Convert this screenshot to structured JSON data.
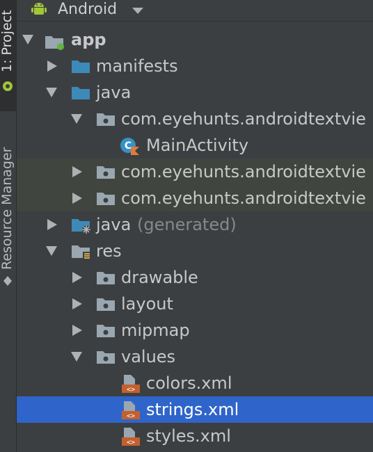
{
  "left_strip": {
    "project_tab": "1: Project",
    "resource_manager_tab": "Resource Manager"
  },
  "header": {
    "view_mode": "Android"
  },
  "tree": {
    "app": "app",
    "manifests": "manifests",
    "java": "java",
    "pkg_main": "com.eyehunts.androidtextvie",
    "main_activity": "MainActivity",
    "pkg_android_test": "com.eyehunts.androidtextvie",
    "pkg_test": "com.eyehunts.androidtextvie",
    "java_generated": "java",
    "generated_suffix": "(generated)",
    "res": "res",
    "drawable": "drawable",
    "layout": "layout",
    "mipmap": "mipmap",
    "values": "values",
    "colors": "colors.xml",
    "strings": "strings.xml",
    "styles": "styles.xml"
  },
  "colors": {
    "background": "#3c3f41",
    "selection": "#2f65ca",
    "highlight_band": "#414540",
    "folder_blue": "#3d8ab8",
    "android_green": "#a4c639"
  }
}
